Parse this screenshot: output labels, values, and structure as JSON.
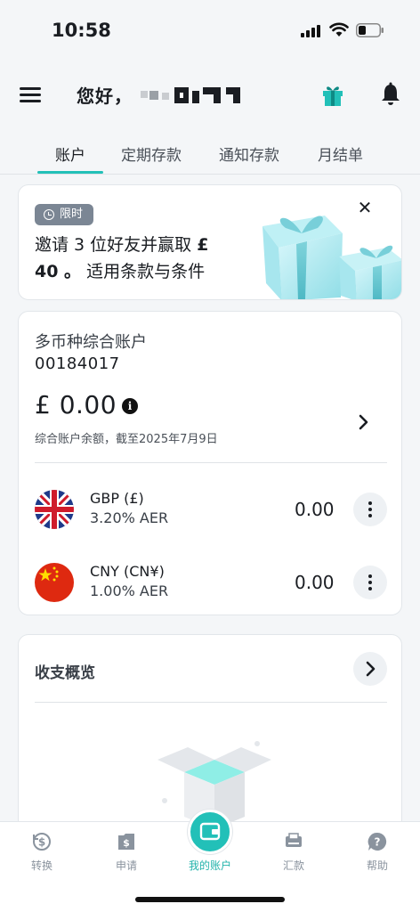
{
  "status_bar": {
    "time": "10:58"
  },
  "header": {
    "greeting": "您好，"
  },
  "tabs": [
    {
      "label": "账户",
      "active": true
    },
    {
      "label": "定期存款",
      "active": false
    },
    {
      "label": "通知存款",
      "active": false
    },
    {
      "label": "月结单",
      "active": false
    }
  ],
  "promo": {
    "badge": "限时",
    "text_part1": "邀请 3 位好友并赢取 ",
    "text_bold1": "£",
    "text_bold2": "40 。",
    "text_part2": " 适用条款与条件",
    "close": "✕"
  },
  "account": {
    "name": "多币种综合账户",
    "number": "00184017",
    "balance": "£ 0.00",
    "info": "i",
    "note": "综合账户余额，截至2025年7月9日",
    "currencies": [
      {
        "code": "GBP (£)",
        "rate": "3.20% AER",
        "amount": "0.00",
        "flag": "uk-flag"
      },
      {
        "code": "CNY (CN¥)",
        "rate": "1.00% AER",
        "amount": "0.00",
        "flag": "cn-flag"
      }
    ]
  },
  "summary": {
    "title": "收支概览"
  },
  "bottom_nav": [
    {
      "label": "转换",
      "icon": "exchange-icon"
    },
    {
      "label": "申请",
      "icon": "apply-icon"
    },
    {
      "label": "我的账户",
      "icon": "wallet-icon",
      "active": true
    },
    {
      "label": "汇款",
      "icon": "transfer-icon"
    },
    {
      "label": "帮助",
      "icon": "help-icon"
    }
  ],
  "colors": {
    "accent": "#22c0b8",
    "background": "#f4f6f8",
    "badge": "#7b8694"
  }
}
